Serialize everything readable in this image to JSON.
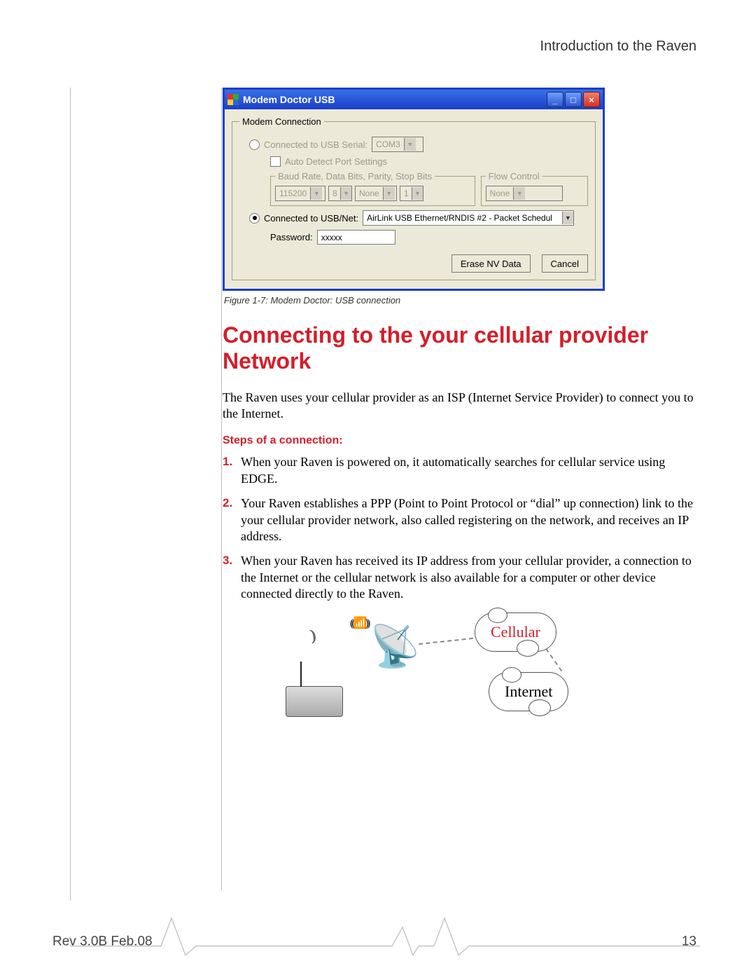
{
  "header": {
    "right": "Introduction to the Raven"
  },
  "window": {
    "title": "Modem Doctor USB",
    "groupbox": "Modem Connection",
    "radio_serial_label": "Connected to USB Serial:",
    "serial_port": "COM3",
    "auto_detect_label": "Auto Detect Port Settings",
    "baud_group": "Baud Rate, Data Bits, Parity, Stop Bits",
    "baud": "115200",
    "data_bits": "8",
    "parity": "None",
    "stop_bits": "1",
    "flow_group": "Flow Control",
    "flow": "None",
    "radio_net_label": "Connected to USB/Net:",
    "net_value": "AirLink USB Ethernet/RNDIS #2 - Packet Schedul",
    "password_label": "Password:",
    "password_value": "xxxxx",
    "erase_btn": "Erase NV Data",
    "cancel_btn": "Cancel"
  },
  "figure_caption": "Figure 1-7: Modem Doctor: USB connection",
  "section_title": "Connecting to the your cellular provider Network",
  "intro": "The Raven uses your cellular provider as an ISP (Internet Service Provider) to connect you to the Internet.",
  "steps_heading": "Steps of a connection:",
  "steps": [
    "When your Raven is powered on, it automatically searches for cellular service using EDGE.",
    "Your Raven establishes a PPP (Point to Point Protocol or “dial” up connection) link to the your cellular provider network, also called registering on the network, and receives an IP address.",
    "When your Raven has received its IP address from your cellular provider, a connection to the Internet or the cellular network is also available for a computer or other device connected directly to the Raven."
  ],
  "diagram": {
    "cellular": "Cellular",
    "internet": "Internet"
  },
  "footer": {
    "rev": "Rev 3.0B  Feb.08",
    "page": "13"
  }
}
